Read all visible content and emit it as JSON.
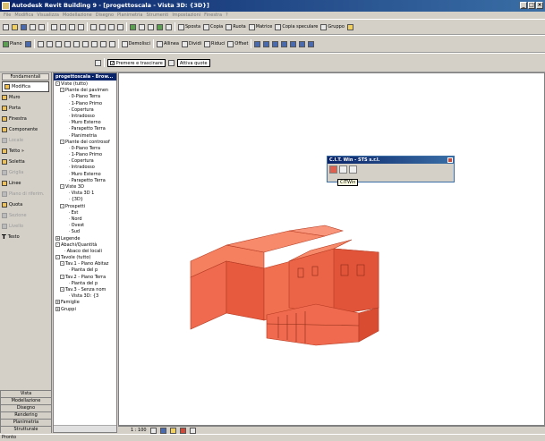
{
  "title": "Autodesk Revit Building 9 - [progettoscala - Vista 3D: {3D}]",
  "menu": [
    "File",
    "Modifica",
    "Visualizza",
    "Modellazione",
    "Disegno",
    "Planimetria",
    "Strumenti",
    "Impostazioni",
    "Finestra",
    "?"
  ],
  "toolbar1": {
    "items": [
      "Sposta",
      "Copia",
      "Ruota",
      "Matrice",
      "Copia speculare",
      "Gruppo"
    ]
  },
  "toolbar2": {
    "piano": "Piano",
    "items": [
      "Demolisci",
      "Allinea",
      "Dividi",
      "Riduci",
      "Offset"
    ]
  },
  "toolbar3": {
    "premere": "Premere e trascinare",
    "attiva": "Attiva quote"
  },
  "left_panel": {
    "header": "Fondamentali",
    "items": [
      {
        "label": "Modifica",
        "enabled": true
      },
      {
        "label": "Muro",
        "enabled": true
      },
      {
        "label": "Porta",
        "enabled": true
      },
      {
        "label": "Finestra",
        "enabled": true
      },
      {
        "label": "Componente",
        "enabled": true
      },
      {
        "label": "Locale",
        "enabled": false
      },
      {
        "label": "Tetto »",
        "enabled": true
      },
      {
        "label": "Soletta",
        "enabled": true
      },
      {
        "label": "Griglia",
        "enabled": false
      },
      {
        "label": "Linee",
        "enabled": true
      },
      {
        "label": "Piano di riferim.",
        "enabled": false
      },
      {
        "label": "Quota",
        "enabled": true
      },
      {
        "label": "Sezione",
        "enabled": false
      },
      {
        "label": "Livello",
        "enabled": false
      },
      {
        "label": "Testo",
        "enabled": true
      }
    ],
    "tabs": [
      "Vista",
      "Modellazione",
      "Disegno",
      "Rendering",
      "Planimetria",
      "Strutturale"
    ]
  },
  "browser": {
    "header": "progettoscala - Brow...",
    "tree": [
      {
        "label": "Viste (tutto)",
        "indent": 0,
        "box": "-"
      },
      {
        "label": "Piante dei pavimen",
        "indent": 1,
        "box": "-"
      },
      {
        "label": "0-Piano Terra",
        "indent": 3,
        "box": ""
      },
      {
        "label": "1-Piano Primo",
        "indent": 3,
        "box": ""
      },
      {
        "label": "Copertura",
        "indent": 3,
        "box": ""
      },
      {
        "label": "Intradosso",
        "indent": 3,
        "box": ""
      },
      {
        "label": "Muro Esterno",
        "indent": 3,
        "box": ""
      },
      {
        "label": "Parapetto Terra",
        "indent": 3,
        "box": ""
      },
      {
        "label": "Planimetria",
        "indent": 3,
        "box": ""
      },
      {
        "label": "Piante dei controsof",
        "indent": 1,
        "box": "-"
      },
      {
        "label": "0-Piano Terra",
        "indent": 3,
        "box": ""
      },
      {
        "label": "1-Piano Primo",
        "indent": 3,
        "box": ""
      },
      {
        "label": "Copertura",
        "indent": 3,
        "box": ""
      },
      {
        "label": "Intradosso",
        "indent": 3,
        "box": ""
      },
      {
        "label": "Muro Esterno",
        "indent": 3,
        "box": ""
      },
      {
        "label": "Parapetto Terra",
        "indent": 3,
        "box": ""
      },
      {
        "label": "Viste 3D",
        "indent": 1,
        "box": "-"
      },
      {
        "label": "Vista 3D 1",
        "indent": 3,
        "box": ""
      },
      {
        "label": "{3D}",
        "indent": 3,
        "box": ""
      },
      {
        "label": "Prospetti",
        "indent": 1,
        "box": "-"
      },
      {
        "label": "Est",
        "indent": 3,
        "box": ""
      },
      {
        "label": "Nord",
        "indent": 3,
        "box": ""
      },
      {
        "label": "Ovest",
        "indent": 3,
        "box": ""
      },
      {
        "label": "Sud",
        "indent": 3,
        "box": ""
      },
      {
        "label": "Legende",
        "indent": 0,
        "box": "+"
      },
      {
        "label": "Abachi/Quantità",
        "indent": 0,
        "box": "-"
      },
      {
        "label": "Abaco dei locali",
        "indent": 2,
        "box": ""
      },
      {
        "label": "Tavole (tutto)",
        "indent": 0,
        "box": "-"
      },
      {
        "label": "Tav.1 - Piano Abitaz",
        "indent": 1,
        "box": "-"
      },
      {
        "label": "Pianta del p",
        "indent": 3,
        "box": ""
      },
      {
        "label": "Tav.2 - Piano Terra",
        "indent": 1,
        "box": "-"
      },
      {
        "label": "Pianta del p",
        "indent": 3,
        "box": ""
      },
      {
        "label": "Tav.3 - Senza nom",
        "indent": 1,
        "box": "-"
      },
      {
        "label": "Vista 3D: {3",
        "indent": 3,
        "box": ""
      },
      {
        "label": "Famiglie",
        "indent": 0,
        "box": "+"
      },
      {
        "label": "Gruppi",
        "indent": 0,
        "box": "+"
      }
    ]
  },
  "float_window": {
    "title": "C.I.T. Win - STS s.r.l.",
    "tooltip": "CITWin"
  },
  "status": {
    "scale": "1 : 100"
  },
  "bottom": {
    "text": "Pronto"
  },
  "colors": {
    "building": "#ef6a4e",
    "title_bar": "#0a246a"
  }
}
